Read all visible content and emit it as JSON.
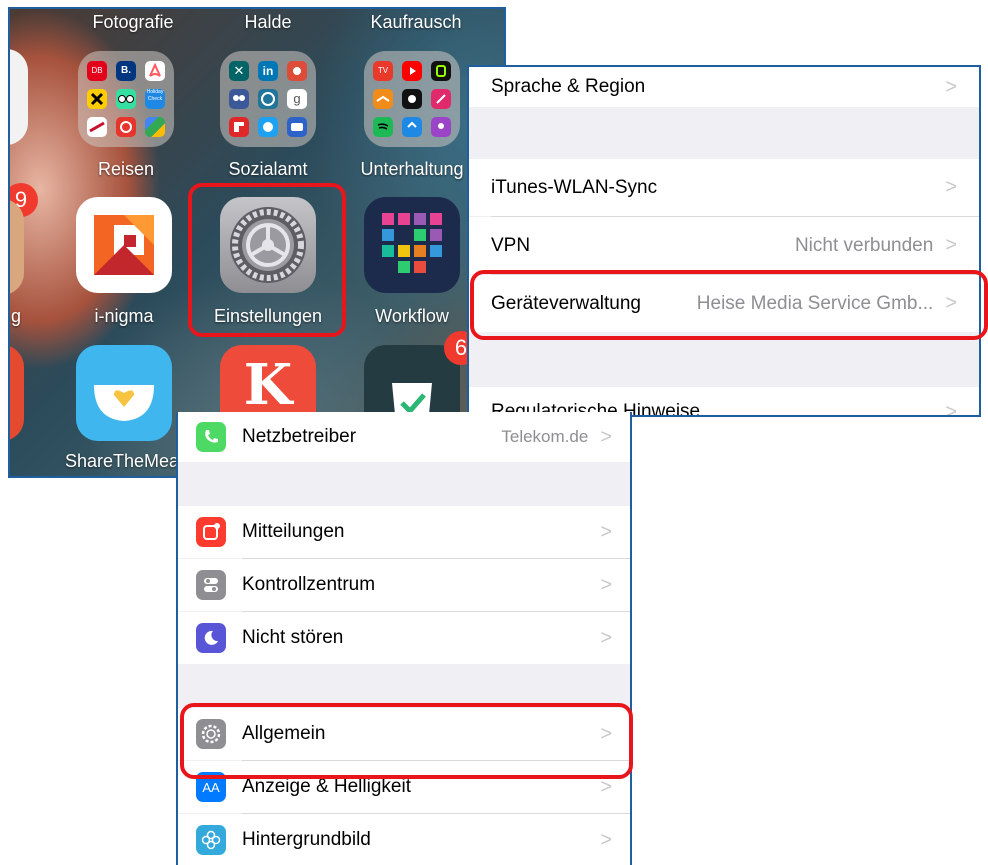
{
  "home_screen": {
    "folders": [
      {
        "label": "Fotografie"
      },
      {
        "label": "Halde"
      },
      {
        "label": "Kaufrausch"
      },
      {
        "label": "Reisen"
      },
      {
        "label": "Sozialamt"
      },
      {
        "label": "Unterhaltung"
      }
    ],
    "apps": [
      {
        "label": "i-nigma"
      },
      {
        "label": "Einstellungen"
      },
      {
        "label": "Workflow"
      },
      {
        "label": "ShareTheMeal"
      }
    ],
    "left_edge_label": "g",
    "badges": [
      "9",
      "6"
    ],
    "mini_icon_text": {
      "bahn": "DB",
      "booking": "B.",
      "holiday": "Holiday Check",
      "xing": "in",
      "tv": "TV"
    }
  },
  "general_panel": {
    "rows": [
      {
        "label": "Sprache & Region",
        "value": ""
      },
      {
        "label": "iTunes-WLAN-Sync",
        "value": ""
      },
      {
        "label": "VPN",
        "value": "Nicht verbunden"
      },
      {
        "label": "Geräteverwaltung",
        "value": "Heise Media Service Gmb..."
      },
      {
        "label": "Regulatorische Hinweise",
        "value": ""
      }
    ],
    "chevron": ">"
  },
  "settings_panel": {
    "rows": [
      {
        "label": "Netzbetreiber",
        "value": "Telekom.de",
        "icon": "phone-icon"
      },
      {
        "label": "Mitteilungen",
        "value": "",
        "icon": "notifications-icon"
      },
      {
        "label": "Kontrollzentrum",
        "value": "",
        "icon": "control-center-icon"
      },
      {
        "label": "Nicht stören",
        "value": "",
        "icon": "moon-icon"
      },
      {
        "label": "Allgemein",
        "value": "",
        "icon": "gear-icon"
      },
      {
        "label": "Anzeige & Helligkeit",
        "value": "",
        "icon": "display-icon",
        "icon_text": "AA"
      },
      {
        "label": "Hintergrundbild",
        "value": "",
        "icon": "wallpaper-icon"
      }
    ],
    "chevron": ">"
  },
  "colors": {
    "highlight": "#e8161b",
    "panel_border": "#1f5f9e",
    "settings_background": "#efeff4",
    "value_gray": "#8e8e93"
  }
}
